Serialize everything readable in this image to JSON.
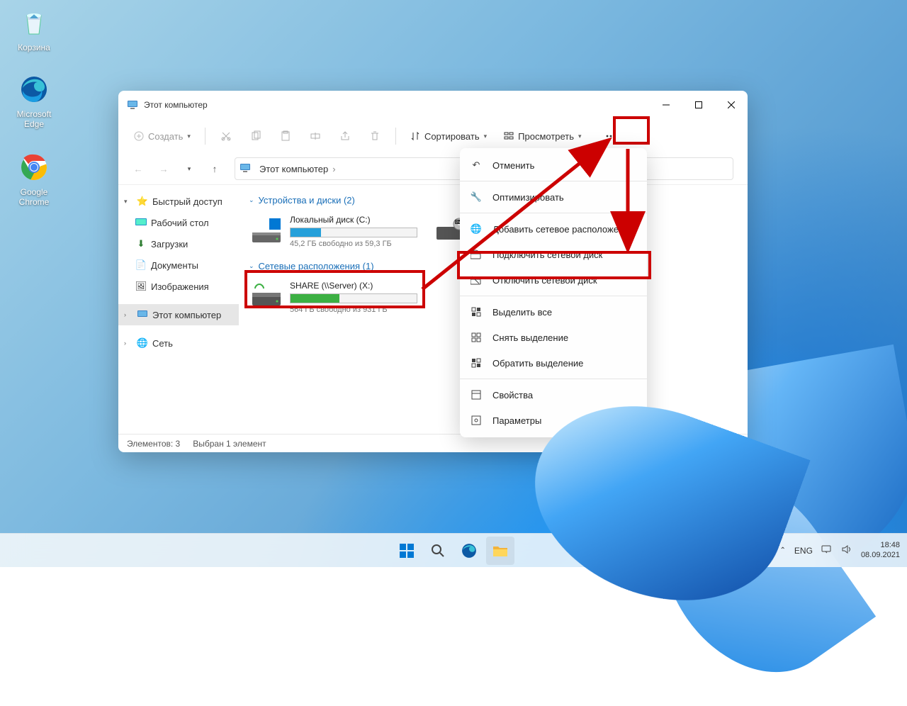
{
  "desktop": {
    "icons": [
      {
        "label": "Корзина",
        "kind": "recycle-bin"
      },
      {
        "label": "Microsoft Edge",
        "kind": "edge"
      },
      {
        "label": "Google Chrome",
        "kind": "chrome"
      }
    ]
  },
  "window": {
    "title": "Этот компьютер",
    "toolbar": {
      "new": "Создать",
      "sort": "Сортировать",
      "view": "Просмотреть"
    },
    "breadcrumb": {
      "root": "Этот компьютер"
    },
    "sidebar": {
      "quick_access": "Быстрый доступ",
      "desktop": "Рабочий стол",
      "downloads": "Загрузки",
      "documents": "Документы",
      "pictures": "Изображения",
      "this_pc": "Этот компьютер",
      "network": "Сеть"
    },
    "groups": {
      "devices": {
        "title": "Устройства и диски (2)"
      },
      "network": {
        "title": "Сетевые расположения (1)"
      }
    },
    "drives": {
      "local": {
        "name": "Локальный диск (C:)",
        "free": "45,2 ГБ свободно из 59,3 ГБ",
        "fill_pct": 24,
        "color": "#26a0da"
      },
      "dvd": {
        "kind": "dvd"
      },
      "share": {
        "name": "SHARE (\\\\Server) (X:)",
        "free": "564 ГБ свободно из 931 ГБ",
        "fill_pct": 39,
        "color": "#3cb043"
      }
    },
    "status": {
      "count": "Элементов: 3",
      "selected": "Выбран 1 элемент"
    }
  },
  "context_menu": {
    "undo": "Отменить",
    "optimize": "Оптимизировать",
    "add_network_location": "Добавить сетевое расположение",
    "map_network_drive": "Подключить сетевой диск",
    "disconnect_network_drive": "Отключить сетевой диск",
    "select_all": "Выделить все",
    "select_none": "Снять выделение",
    "invert_selection": "Обратить выделение",
    "properties": "Свойства",
    "options": "Параметры"
  },
  "taskbar": {
    "lang": "ENG",
    "time": "18:48",
    "date": "08.09.2021"
  }
}
